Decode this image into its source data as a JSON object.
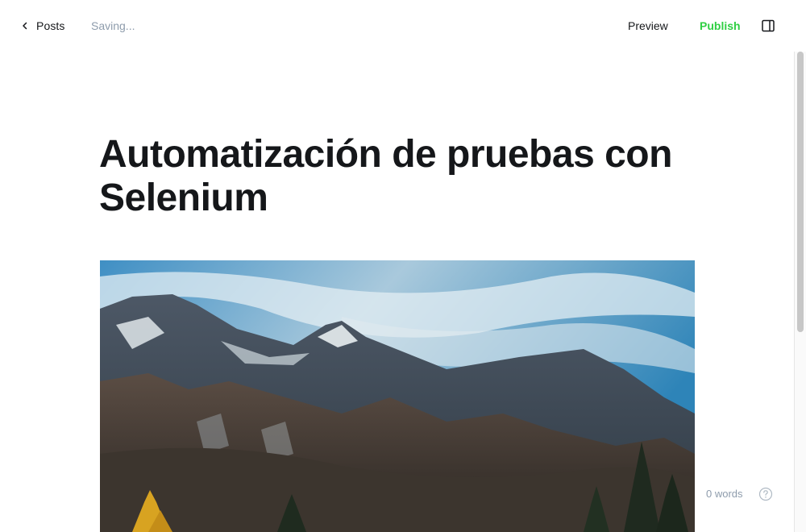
{
  "header": {
    "back_label": "Posts",
    "status": "Saving...",
    "preview_label": "Preview",
    "publish_label": "Publish",
    "publish_color": "#30cf43",
    "icons": {
      "back": "chevron-left-icon",
      "settings": "sidebar-toggle-icon"
    }
  },
  "editor": {
    "title": "Automatización de pruebas con Selenium",
    "feature_image": {
      "description_icon": "mountain-landscape-image"
    }
  },
  "footer": {
    "word_count": "0 words",
    "help_icon": "question-circle-icon"
  },
  "colors": {
    "muted_text": "#8e9cac",
    "primary_text": "#15171a"
  }
}
